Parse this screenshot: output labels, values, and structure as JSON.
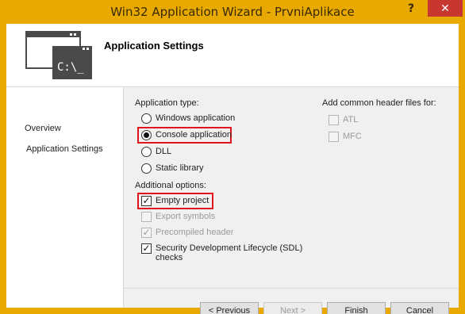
{
  "window": {
    "title": "Win32 Application Wizard - PrvniAplikace",
    "help": "?",
    "close": "✕"
  },
  "header": {
    "title": "Application Settings",
    "icon_text": "C:\\_"
  },
  "nav": {
    "items": [
      "Overview",
      "Application Settings"
    ]
  },
  "app_type": {
    "label": "Application type:",
    "options": [
      {
        "label": "Windows application",
        "selected": false
      },
      {
        "label": "Console application",
        "selected": true
      },
      {
        "label": "DLL",
        "selected": false
      },
      {
        "label": "Static library",
        "selected": false
      }
    ]
  },
  "additional": {
    "label": "Additional options:",
    "options": [
      {
        "label": "Empty project",
        "checked": true,
        "enabled": true
      },
      {
        "label": "Export symbols",
        "checked": false,
        "enabled": false
      },
      {
        "label": "Precompiled header",
        "checked": true,
        "enabled": false
      },
      {
        "label": "Security Development Lifecycle (SDL)",
        "label2": "checks",
        "checked": true,
        "enabled": true
      }
    ]
  },
  "headers": {
    "label": "Add common header files for:",
    "options": [
      {
        "label": "ATL",
        "checked": false,
        "enabled": false
      },
      {
        "label": "MFC",
        "checked": false,
        "enabled": false
      }
    ]
  },
  "buttons": {
    "previous": "< Previous",
    "next": "Next >",
    "finish": "Finish",
    "cancel": "Cancel"
  },
  "colors": {
    "title_bar": "#e8a900",
    "close": "#c7372f",
    "highlight": "#e0141e"
  }
}
